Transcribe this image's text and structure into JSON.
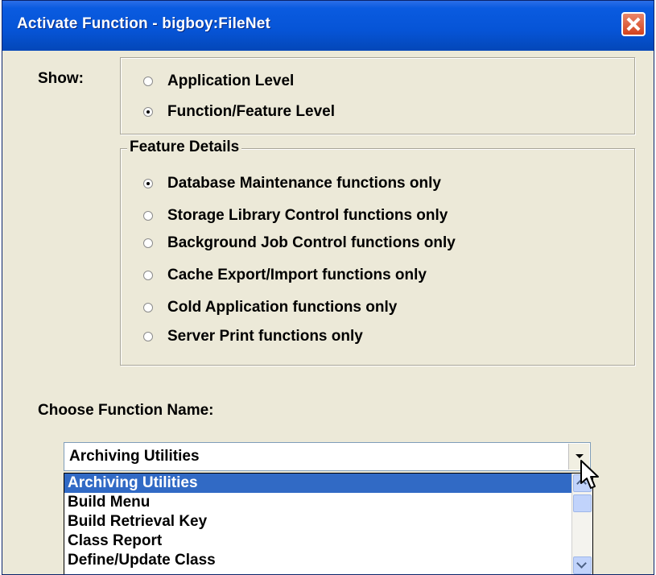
{
  "window": {
    "title": "Activate Function - bigboy:FileNet"
  },
  "show": {
    "label": "Show:",
    "options": [
      {
        "label": "Application Level",
        "checked": false
      },
      {
        "label": "Function/Feature Level",
        "checked": true
      }
    ]
  },
  "feature_details": {
    "legend": "Feature Details",
    "options": [
      {
        "label": "Database Maintenance functions only",
        "checked": true
      },
      {
        "label": "Storage Library Control functions only",
        "checked": false
      },
      {
        "label": "Background Job Control functions only",
        "checked": false
      },
      {
        "label": "Cache Export/Import functions only",
        "checked": false
      },
      {
        "label": "Cold Application functions only",
        "checked": false
      },
      {
        "label": "Server Print functions only",
        "checked": false
      }
    ]
  },
  "function_name": {
    "label": "Choose Function Name:",
    "selected": "Archiving Utilities",
    "options": [
      "Archiving Utilities",
      "Build Menu",
      "Build Retrieval Key",
      "Class Report",
      "Define/Update Class"
    ]
  }
}
